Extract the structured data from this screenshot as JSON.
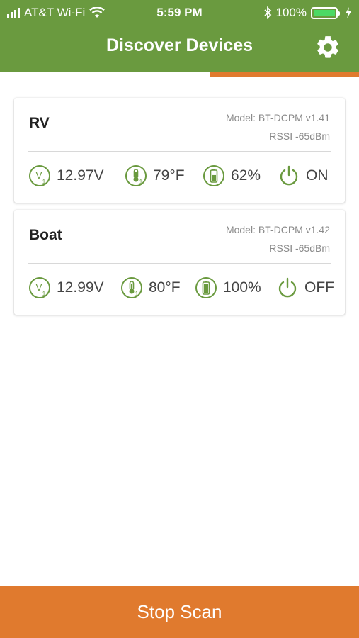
{
  "colors": {
    "brand": "#6a9a3f",
    "accent": "#e07a2e",
    "icon_green": "#6a9a3f"
  },
  "status_bar": {
    "carrier": "AT&T Wi-Fi",
    "time": "5:59 PM",
    "battery": "100%"
  },
  "header": {
    "title": "Discover Devices",
    "settings_icon": "gear-icon"
  },
  "devices": [
    {
      "name": "RV",
      "model": "Model: BT-DCPM v1.41",
      "rssi": "RSSI -65dBm",
      "voltage": "12.97V",
      "temperature": "79°F",
      "battery": "62%",
      "battery_level": 0.62,
      "power": "ON"
    },
    {
      "name": "Boat",
      "model": "Model: BT-DCPM v1.42",
      "rssi": "RSSI -65dBm",
      "voltage": "12.99V",
      "temperature": "80°F",
      "battery": "100%",
      "battery_level": 1.0,
      "power": "OFF"
    }
  ],
  "footer": {
    "stop_scan_label": "Stop Scan"
  }
}
